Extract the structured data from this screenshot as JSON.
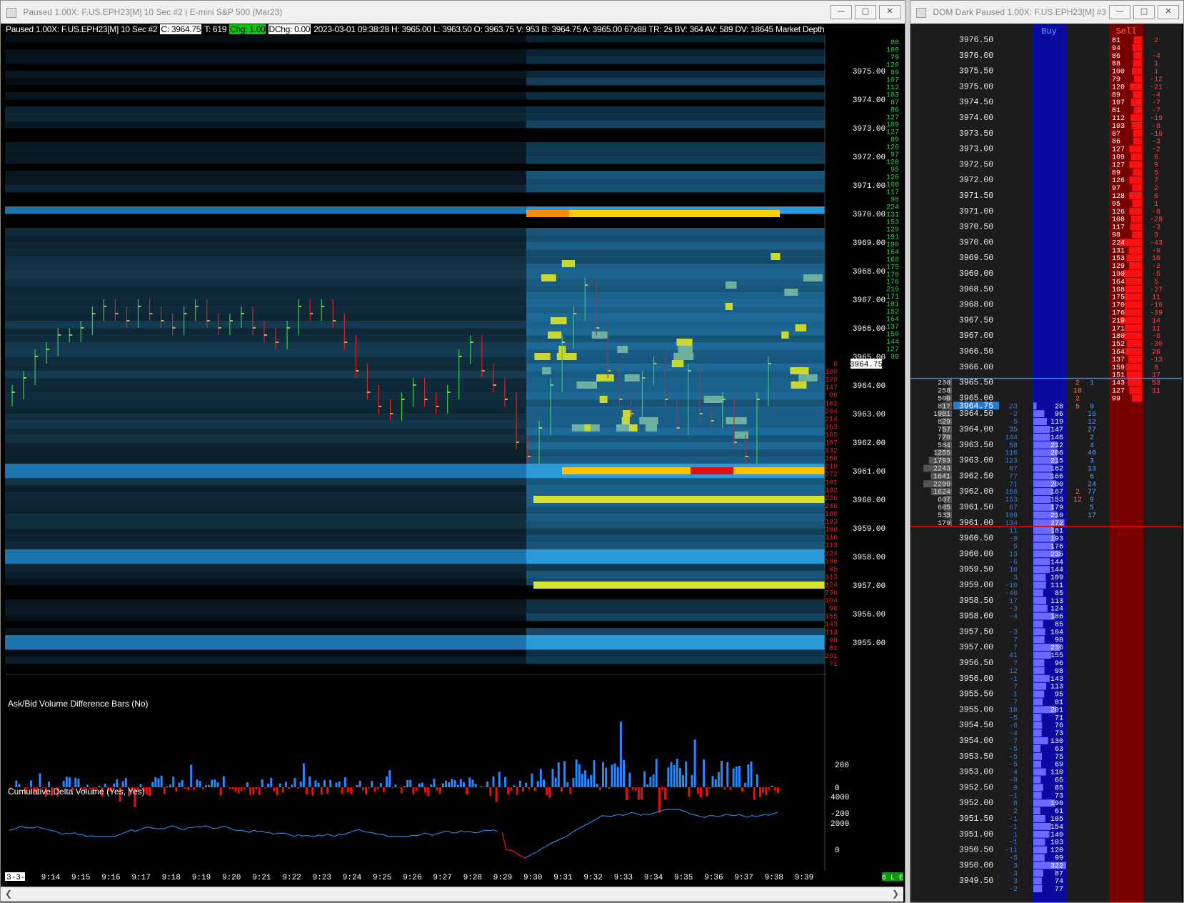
{
  "chart_window": {
    "title": "Paused 1.00X: F.US.EPH23[M]  10 Sec   #2 | E-mini S&P 500 (Mar23)",
    "info": {
      "prefix": "Paused 1.00X: F.US.EPH23[M]  10 Sec   #2",
      "close": "C: 3964.75",
      "trades": "T: 619",
      "chg": "Chg: 1.00",
      "dchg": "DChg: 0.00",
      "rest": "2023-03-01 09:38:28 H: 3965.00 L: 3963.50 O: 3963.75 V: 953 B: 3964.75 A: 3965.00 67x88 TR: 2s BV: 364 AV: 589 DV: 18645 Market Depth Histo"
    },
    "price_axis": [
      "3975.00",
      "3974.00",
      "3973.00",
      "3972.00",
      "3971.00",
      "3970.00",
      "3969.00",
      "3968.00",
      "3967.00",
      "3966.00",
      "3965.00",
      "3964.00",
      "3963.00",
      "3962.00",
      "3961.00",
      "3960.00",
      "3959.00",
      "3958.00",
      "3957.00",
      "3956.00",
      "3955.00"
    ],
    "current_price": "3964.75",
    "ask_depth": [
      "88",
      "100",
      "79",
      "120",
      "89",
      "107",
      "112",
      "103",
      "87",
      "86",
      "127",
      "109",
      "127",
      "89",
      "126",
      "97",
      "128",
      "95",
      "126",
      "108",
      "117",
      "98",
      "224",
      "131",
      "153",
      "129",
      "191",
      "190",
      "164",
      "168",
      "175",
      "170",
      "176",
      "219",
      "171",
      "181",
      "152",
      "164",
      "137",
      "150",
      "144",
      "127",
      "99"
    ],
    "bid_depth": [
      "6",
      "100",
      "120",
      "147",
      "96",
      "181",
      "204",
      "214",
      "163",
      "165",
      "167",
      "132",
      "166",
      "210",
      "272",
      "181",
      "192",
      "226",
      "246",
      "180",
      "193",
      "108",
      "116",
      "113",
      "124",
      "186",
      "85",
      "113",
      "124",
      "236",
      "104",
      "96",
      "155",
      "143",
      "113",
      "98",
      "81",
      "201",
      "71"
    ],
    "delta_pane": {
      "title": "Ask/Bid Volume Difference Bars   (No)",
      "scale": [
        "200",
        "0",
        "-200"
      ]
    },
    "cdv_pane": {
      "title": "Cumulative Delta Volume   (Yes, Yes)",
      "scale": [
        "4000",
        "2000",
        "0"
      ]
    },
    "time_axis": [
      "3-3-1",
      "9:14",
      "9:15",
      "9:16",
      "9:17",
      "9:18",
      "9:19",
      "9:20",
      "9:21",
      "9:22",
      "9:23",
      "9:24",
      "9:25",
      "9:26",
      "9:27",
      "9:28",
      "9:29",
      "9:30",
      "9:31",
      "9:32",
      "9:33",
      "9:34",
      "9:35",
      "9:36",
      "9:37",
      "9:38",
      "9:39"
    ],
    "status_badge": "6 L E"
  },
  "dom_window": {
    "title": "DOM Dark Paused 1.00X: F.US.EPH23[M]  #3 ...",
    "buy_header": "Buy",
    "sell_header": "Sell",
    "upper_rows": [
      {
        "price": "3976.50",
        "sell": "81",
        "diff": "2"
      },
      {
        "price": "",
        "sell": "94",
        "diff": ""
      },
      {
        "price": "3976.00",
        "sell": "86",
        "diff": "-4"
      },
      {
        "price": "",
        "sell": "88",
        "diff": "1"
      },
      {
        "price": "3975.50",
        "sell": "100",
        "diff": "1"
      },
      {
        "price": "",
        "sell": "79",
        "diff": "-12"
      },
      {
        "price": "3975.00",
        "sell": "120",
        "diff": "-21"
      },
      {
        "price": "",
        "sell": "89",
        "diff": "-4"
      },
      {
        "price": "3974.50",
        "sell": "107",
        "diff": "-7"
      },
      {
        "price": "",
        "sell": "81",
        "diff": "-7"
      },
      {
        "price": "3974.00",
        "sell": "112",
        "diff": "-19"
      },
      {
        "price": "",
        "sell": "103",
        "diff": "-8"
      },
      {
        "price": "3973.50",
        "sell": "87",
        "diff": "-10"
      },
      {
        "price": "",
        "sell": "86",
        "diff": "-3"
      },
      {
        "price": "3973.00",
        "sell": "127",
        "diff": "-2"
      },
      {
        "price": "",
        "sell": "109",
        "diff": "6"
      },
      {
        "price": "3972.50",
        "sell": "127",
        "diff": "9"
      },
      {
        "price": "",
        "sell": "89",
        "diff": "5"
      },
      {
        "price": "3972.00",
        "sell": "126",
        "diff": "7"
      },
      {
        "price": "",
        "sell": "97",
        "diff": "2"
      },
      {
        "price": "3971.50",
        "sell": "128",
        "diff": "6"
      },
      {
        "price": "",
        "sell": "95",
        "diff": "1"
      },
      {
        "price": "3971.00",
        "sell": "126",
        "diff": "-8"
      },
      {
        "price": "",
        "sell": "108",
        "diff": "-28"
      },
      {
        "price": "3970.50",
        "sell": "117",
        "diff": "-3"
      },
      {
        "price": "",
        "sell": "98",
        "diff": "3"
      },
      {
        "price": "3970.00",
        "sell": "224",
        "diff": "-43"
      },
      {
        "price": "",
        "sell": "131",
        "diff": "-9"
      },
      {
        "price": "3969.50",
        "sell": "153",
        "diff": "16"
      },
      {
        "price": "",
        "sell": "129",
        "diff": "-2"
      },
      {
        "price": "3969.00",
        "sell": "190",
        "diff": "-5"
      },
      {
        "price": "",
        "sell": "164",
        "diff": "5"
      },
      {
        "price": "3968.50",
        "sell": "168",
        "diff": "-27"
      },
      {
        "price": "",
        "sell": "175",
        "diff": "11"
      },
      {
        "price": "3968.00",
        "sell": "170",
        "diff": "-10"
      },
      {
        "price": "",
        "sell": "176",
        "diff": "-39"
      },
      {
        "price": "3967.50",
        "sell": "219",
        "diff": "14"
      },
      {
        "price": "",
        "sell": "171",
        "diff": "11"
      },
      {
        "price": "3967.00",
        "sell": "180",
        "diff": "-6"
      },
      {
        "price": "",
        "sell": "152",
        "diff": "-30"
      },
      {
        "price": "3966.50",
        "sell": "164",
        "diff": "26"
      },
      {
        "price": "",
        "sell": "137",
        "diff": "-13"
      },
      {
        "price": "3966.00",
        "sell": "159",
        "diff": "8"
      },
      {
        "price": "",
        "sell": "151",
        "diff": "17"
      }
    ],
    "mid_rows": [
      {
        "vol": "230",
        "price": "3965.50",
        "bid": "",
        "buy": "",
        "s1": "2",
        "s2": "1",
        "sell": "143",
        "diff": "53"
      },
      {
        "vol": "258",
        "price": "",
        "bid": "",
        "buy": "",
        "s1": "18",
        "s2": "",
        "sell": "127",
        "diff": "11"
      },
      {
        "vol": "500",
        "price": "3965.00",
        "bid": "",
        "buy": "",
        "s1": "2",
        "s2": "",
        "sell": "99",
        "diff": ""
      },
      {
        "vol": "817",
        "price": "3964.75",
        "bid": "23",
        "buy": "28",
        "s1": "5",
        "s2": "9",
        "sell": "",
        "diff": ""
      },
      {
        "vol": "1081",
        "price": "3964.50",
        "bid": "-2",
        "buy": "96",
        "s1": "",
        "s2": "16",
        "sell": "",
        "diff": ""
      },
      {
        "vol": "829",
        "price": "",
        "bid": "5",
        "buy": "119",
        "s1": "",
        "s2": "12",
        "sell": "",
        "diff": ""
      },
      {
        "vol": "757",
        "price": "3964.00",
        "bid": "35",
        "buy": "147",
        "s1": "",
        "s2": "27",
        "sell": "",
        "diff": ""
      },
      {
        "vol": "770",
        "price": "",
        "bid": "144",
        "buy": "146",
        "s1": "",
        "s2": "2",
        "sell": "",
        "diff": ""
      },
      {
        "vol": "584",
        "price": "3963.50",
        "bid": "58",
        "buy": "212",
        "s1": "",
        "s2": "4",
        "sell": "",
        "diff": ""
      },
      {
        "vol": "1255",
        "price": "",
        "bid": "116",
        "buy": "206",
        "s1": "",
        "s2": "40",
        "sell": "",
        "diff": ""
      },
      {
        "vol": "1793",
        "price": "3963.00",
        "bid": "123",
        "buy": "215",
        "s1": "",
        "s2": "3",
        "sell": "",
        "diff": ""
      },
      {
        "vol": "2243",
        "price": "",
        "bid": "67",
        "buy": "162",
        "s1": "",
        "s2": "13",
        "sell": "",
        "diff": ""
      },
      {
        "vol": "1641",
        "price": "3962.50",
        "bid": "77",
        "buy": "166",
        "s1": "",
        "s2": "6",
        "sell": "",
        "diff": ""
      },
      {
        "vol": "2299",
        "price": "",
        "bid": "71",
        "buy": "200",
        "s1": "",
        "s2": "24",
        "sell": "",
        "diff": ""
      },
      {
        "vol": "1624",
        "price": "3962.00",
        "bid": "166",
        "buy": "167",
        "s1": "2",
        "s2": "77",
        "sell": "",
        "diff": ""
      },
      {
        "vol": "607",
        "price": "",
        "bid": "153",
        "buy": "153",
        "s1": "12",
        "s2": "9",
        "sell": "",
        "diff": ""
      },
      {
        "vol": "605",
        "price": "3961.50",
        "bid": "67",
        "buy": "179",
        "s1": "",
        "s2": "5",
        "sell": "",
        "diff": ""
      },
      {
        "vol": "533",
        "price": "",
        "bid": "109",
        "buy": "210",
        "s1": "",
        "s2": "17",
        "sell": "",
        "diff": ""
      },
      {
        "vol": "179",
        "price": "3961.00",
        "bid": "134",
        "buy": "272",
        "s1": "",
        "s2": "",
        "sell": "",
        "diff": ""
      }
    ],
    "lower_rows": [
      {
        "price": "",
        "bid": "11",
        "buy": "181"
      },
      {
        "price": "3960.50",
        "bid": "-8",
        "buy": "193"
      },
      {
        "price": "",
        "bid": "5",
        "buy": "176"
      },
      {
        "price": "3960.00",
        "bid": "13",
        "buy": "236"
      },
      {
        "price": "",
        "bid": "-6",
        "buy": "144"
      },
      {
        "price": "3959.50",
        "bid": "10",
        "buy": "144"
      },
      {
        "price": "",
        "bid": "3",
        "buy": "109"
      },
      {
        "price": "3959.00",
        "bid": "-10",
        "buy": "111"
      },
      {
        "price": "",
        "bid": "-40",
        "buy": "85"
      },
      {
        "price": "3958.50",
        "bid": "17",
        "buy": "113"
      },
      {
        "price": "",
        "bid": "-3",
        "buy": "124"
      },
      {
        "price": "3958.00",
        "bid": "-4",
        "buy": "186"
      },
      {
        "price": "",
        "bid": "",
        "buy": "85"
      },
      {
        "price": "3957.50",
        "bid": "-3",
        "buy": "104"
      },
      {
        "price": "",
        "bid": "7",
        "buy": "98"
      },
      {
        "price": "3957.00",
        "bid": "7",
        "buy": "236"
      },
      {
        "price": "",
        "bid": "41",
        "buy": "155"
      },
      {
        "price": "3956.50",
        "bid": "7",
        "buy": "96"
      },
      {
        "price": "",
        "bid": "12",
        "buy": "98"
      },
      {
        "price": "3956.00",
        "bid": "-1",
        "buy": "143"
      },
      {
        "price": "",
        "bid": "7",
        "buy": "113"
      },
      {
        "price": "3955.50",
        "bid": "1",
        "buy": "95"
      },
      {
        "price": "",
        "bid": "7",
        "buy": "81"
      },
      {
        "price": "3955.00",
        "bid": "18",
        "buy": "201"
      },
      {
        "price": "",
        "bid": "-5",
        "buy": "71"
      },
      {
        "price": "3954.50",
        "bid": "-6",
        "buy": "76"
      },
      {
        "price": "",
        "bid": "-4",
        "buy": "73"
      },
      {
        "price": "3954.00",
        "bid": "7",
        "buy": "130"
      },
      {
        "price": "",
        "bid": "-5",
        "buy": "63"
      },
      {
        "price": "3953.50",
        "bid": "-5",
        "buy": "75"
      },
      {
        "price": "",
        "bid": "-5",
        "buy": "69"
      },
      {
        "price": "3953.00",
        "bid": "4",
        "buy": "110"
      },
      {
        "price": "",
        "bid": "-8",
        "buy": "65"
      },
      {
        "price": "3952.50",
        "bid": "9",
        "buy": "85"
      },
      {
        "price": "",
        "bid": "-1",
        "buy": "73"
      },
      {
        "price": "3952.00",
        "bid": "8",
        "buy": "190"
      },
      {
        "price": "",
        "bid": "2",
        "buy": "61"
      },
      {
        "price": "3951.50",
        "bid": "-1",
        "buy": "105"
      },
      {
        "price": "",
        "bid": "-1",
        "buy": "154"
      },
      {
        "price": "3951.00",
        "bid": "1",
        "buy": "140"
      },
      {
        "price": "",
        "bid": "-1",
        "buy": "103"
      },
      {
        "price": "3950.50",
        "bid": "-11",
        "buy": "120"
      },
      {
        "price": "",
        "bid": "-5",
        "buy": "99"
      },
      {
        "price": "3950.00",
        "bid": "3",
        "buy": "322"
      },
      {
        "price": "",
        "bid": "3",
        "buy": "87"
      },
      {
        "price": "3949.50",
        "bid": "3",
        "buy": "74"
      },
      {
        "price": "",
        "bid": "-2",
        "buy": "77"
      }
    ]
  },
  "colors": {
    "bid_blue": "#3a7ad8",
    "ask_red": "#e01010",
    "heat_low": "#1c6a9c",
    "heat_high": "#ffe000",
    "up_bar": "#2a88ff",
    "down_bar": "#ee1010"
  }
}
